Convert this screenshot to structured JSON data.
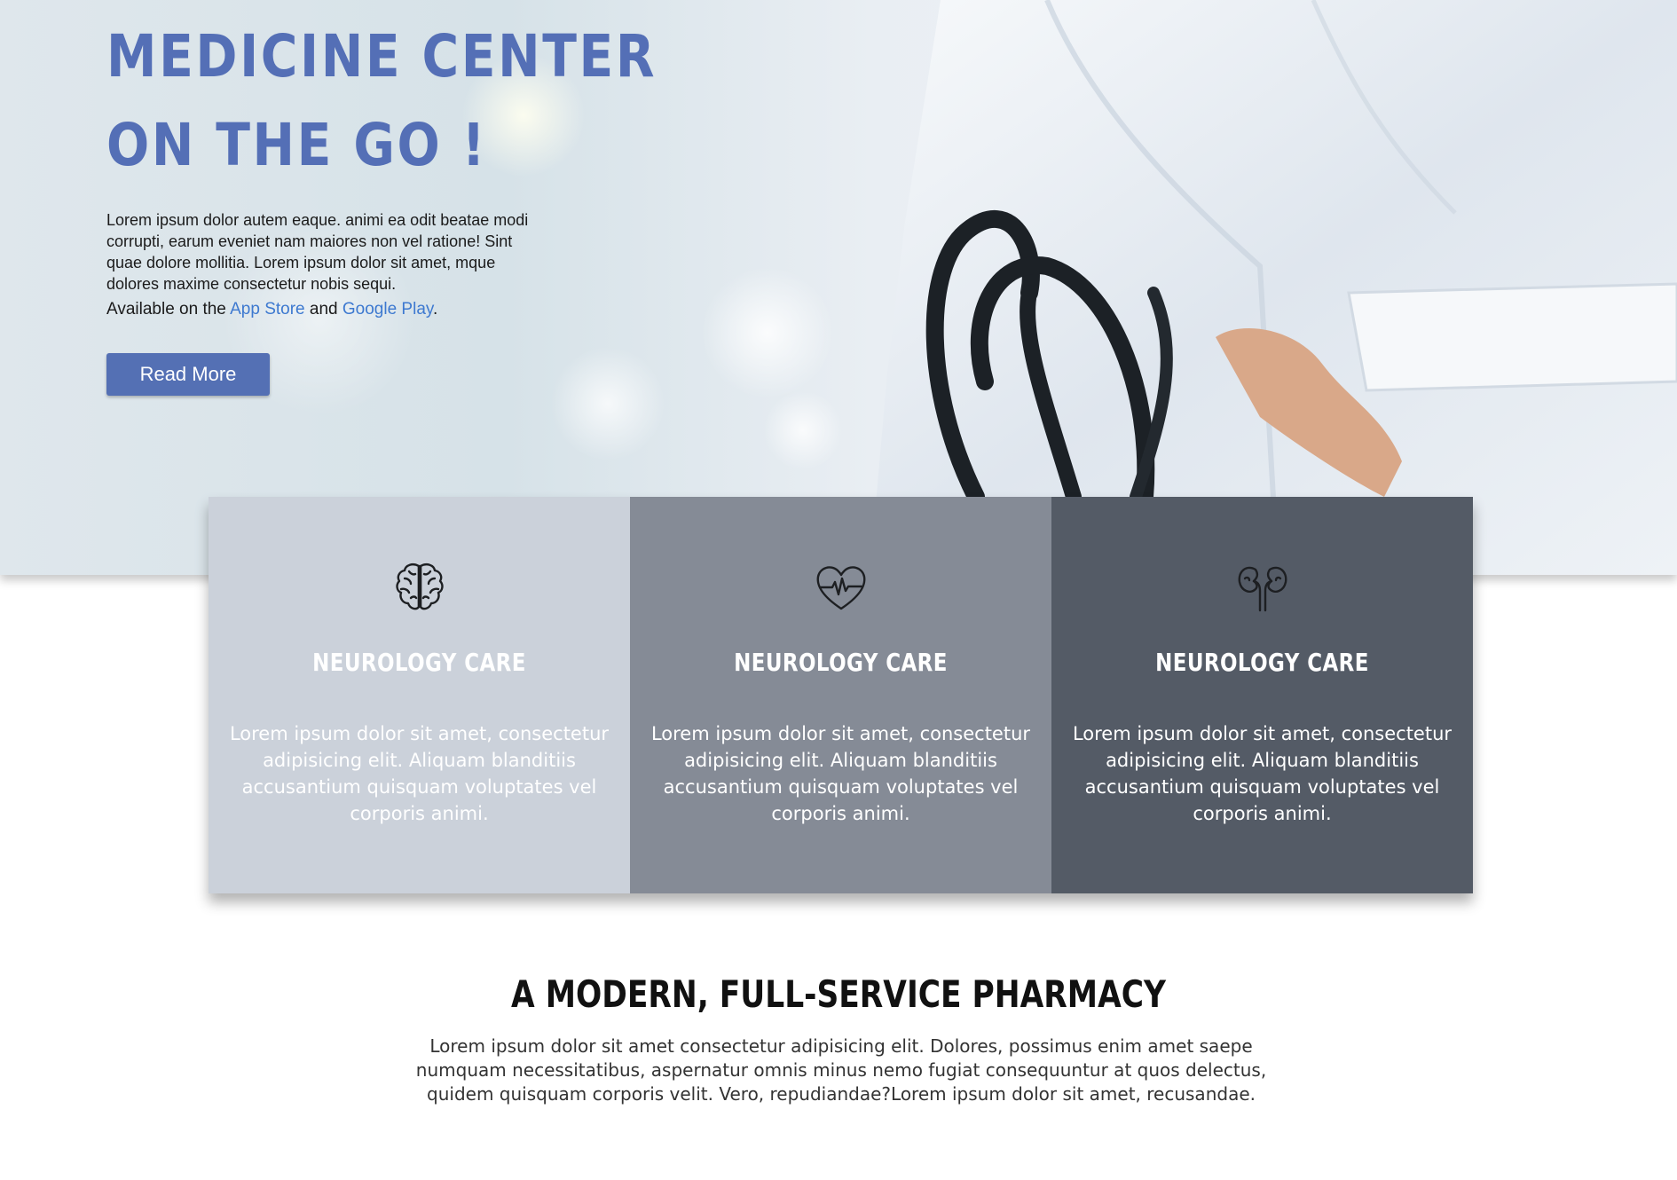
{
  "hero": {
    "title_line1": "MEDICINE CENTER",
    "title_line2": "ON THE GO !",
    "description": "Lorem ipsum dolor autem eaque. animi ea odit beatae modi corrupti, earum eveniet nam maiores non vel ratione! Sint quae dolore mollitia. Lorem ipsum dolor sit amet, mque dolores maxime consectetur nobis sequi.",
    "availability": {
      "prefix": "Available on the ",
      "app_store": "App Store",
      "conjunction": " and ",
      "google_play": "Google Play",
      "suffix": "."
    },
    "read_more": "Read More",
    "title_color": "#546fb6",
    "button_color": "#5470b4",
    "link_color": "#3d79d0"
  },
  "cards": [
    {
      "icon": "brain-icon",
      "title": "NEUROLOGY CARE",
      "text": "Lorem ipsum dolor sit amet, consectetur adipisicing elit. Aliquam blanditiis accusantium quisquam voluptates vel corporis animi.",
      "bg": "#cbd1da",
      "title_color": "#ffffff",
      "text_color": "#ffffff"
    },
    {
      "icon": "heartbeat-icon",
      "title": "NEUROLOGY CARE",
      "text": "Lorem ipsum dolor sit amet, consectetur adipisicing elit. Aliquam blanditiis accusantium quisquam voluptates vel corporis animi.",
      "bg": "#858b96",
      "title_color": "#ffffff",
      "text_color": "#ffffff"
    },
    {
      "icon": "kidneys-icon",
      "title": "NEUROLOGY CARE",
      "text": "Lorem ipsum dolor sit amet, consectetur adipisicing elit. Aliquam blanditiis accusantium quisquam voluptates vel corporis animi.",
      "bg": "#545b66",
      "title_color": "#ffffff",
      "text_color": "#ffffff"
    }
  ],
  "pharmacy": {
    "title": "A MODERN, FULL-SERVICE PHARMACY",
    "text": "Lorem ipsum dolor sit amet consectetur adipisicing elit. Dolores, possimus enim amet saepe numquam necessitatibus, aspernatur omnis minus nemo fugiat consequuntur at quos delectus, quidem quisquam corporis velit. Vero, repudiandae?Lorem ipsum dolor sit amet, recusandae."
  }
}
